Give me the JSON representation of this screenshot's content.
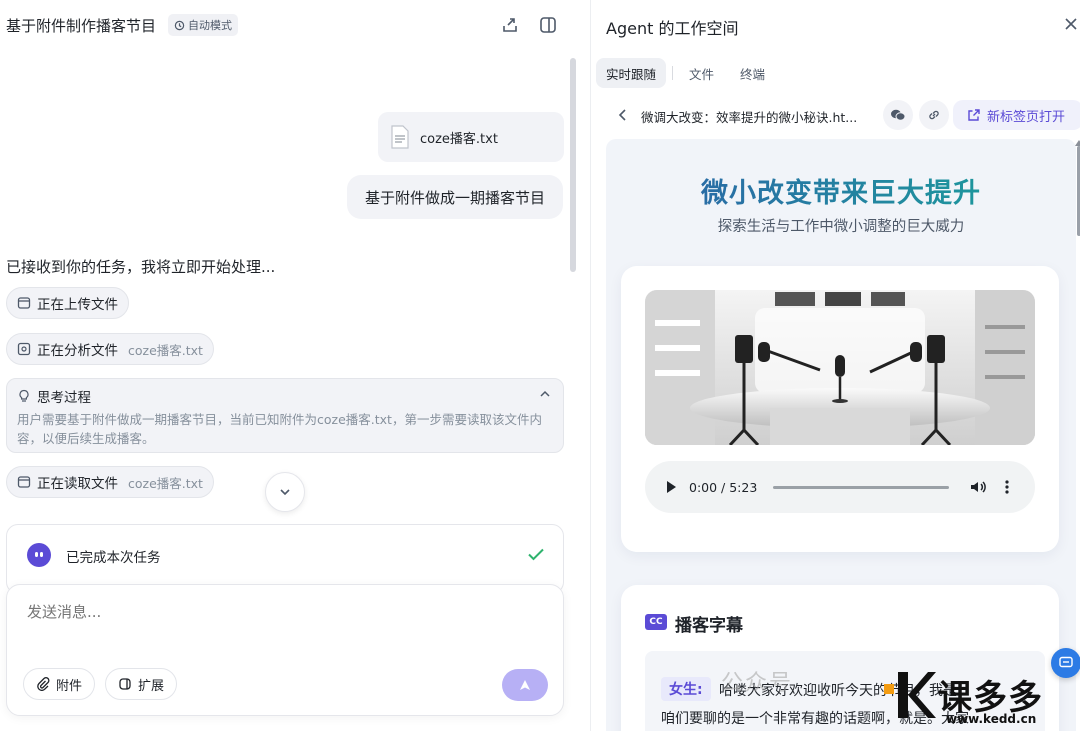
{
  "left": {
    "title": "基于附件制作播客节目",
    "mode_badge": "自动模式",
    "file_name": "coze播客.txt",
    "user_message": "基于附件做成一期播客节目",
    "received": "已接收到你的任务，我将立即开始处理...",
    "steps": [
      {
        "label": "正在上传文件",
        "sub": ""
      },
      {
        "label": "正在分析文件",
        "sub": "coze播客.txt"
      },
      {
        "label": "正在读取文件",
        "sub": "coze播客.txt"
      }
    ],
    "thinking": {
      "title": "思考过程",
      "body": "用户需要基于附件做成一期播客节目，当前已知附件为coze播客.txt，第一步需要读取该文件内容，以便后续生成播客。"
    },
    "done": "已完成本次任务",
    "composer": {
      "placeholder": "发送消息...",
      "attach_label": "附件",
      "extend_label": "扩展"
    }
  },
  "right": {
    "title": "Agent 的工作空间",
    "tabs": [
      "实时跟随",
      "文件",
      "终端"
    ],
    "url_title": "微调大改变：效率提升的微小秘诀.ht...",
    "open_new_tab": "新标签页打开",
    "page": {
      "hero_title": "微小改变带来巨大提升",
      "hero_subtitle": "探索生活与工作中微小调整的巨大威力",
      "audio_time": "0:00 / 5:23",
      "audio_progress": 0,
      "cc_badge": "CC",
      "subtitles_title": "播客字幕",
      "speaker": "女生:",
      "line1": "哈喽大家好欢迎收听今天的节目，我是",
      "line2": "咱们要聊的是一个非常有趣的话题啊，就是。大家"
    }
  },
  "watermark": {
    "wechat": "公众号",
    "brand": "课多多",
    "site": "www.kedd.cn"
  },
  "colors": {
    "accent": "#5b4bd6",
    "success": "#2fb36e",
    "link_blue": "#2c7be5"
  }
}
